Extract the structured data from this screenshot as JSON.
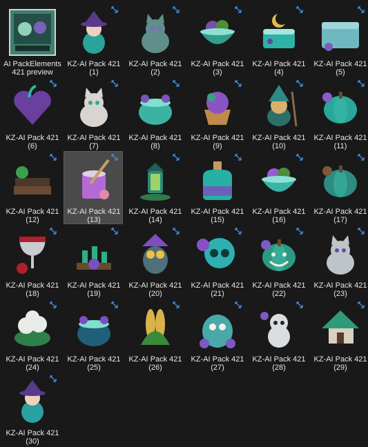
{
  "explorer": {
    "items": [
      {
        "line1": "AI PackElements",
        "line2": "421 preview",
        "kind": "preview",
        "color": "#3f7f6f",
        "accent": "#8fd3b8"
      },
      {
        "line1": "KZ-AI Pack 421",
        "line2": "(1)",
        "kind": "girl",
        "color": "#2aa39a",
        "accent": "#5b3a8c"
      },
      {
        "line1": "KZ-AI Pack 421",
        "line2": "(2)",
        "kind": "cat",
        "color": "#5f8f8a",
        "accent": "#8a67c4"
      },
      {
        "line1": "KZ-AI Pack 421",
        "line2": "(3)",
        "kind": "bowl",
        "color": "#2f9e8a",
        "accent": "#7a4ea8"
      },
      {
        "line1": "KZ-AI Pack 421",
        "line2": "(4)",
        "kind": "cake",
        "color": "#2bb3a5",
        "accent": "#6b42a3"
      },
      {
        "line1": "KZ-AI Pack 421",
        "line2": "(5)",
        "kind": "box",
        "color": "#6fb8c0",
        "accent": "#7f5bc0"
      },
      {
        "line1": "KZ-AI Pack 421",
        "line2": "(6)",
        "kind": "heart",
        "color": "#6a3fa0",
        "accent": "#2fb3a7"
      },
      {
        "line1": "KZ-AI Pack 421",
        "line2": "(7)",
        "kind": "cat",
        "color": "#d9d4cf",
        "accent": "#2fa89a"
      },
      {
        "line1": "KZ-AI Pack 421",
        "line2": "(8)",
        "kind": "cauldron",
        "color": "#3cb3a1",
        "accent": "#7a56b6"
      },
      {
        "line1": "KZ-AI Pack 421",
        "line2": "(9)",
        "kind": "cupcake",
        "color": "#c08a4a",
        "accent": "#8a55c2"
      },
      {
        "line1": "KZ-AI Pack 421",
        "line2": "(10)",
        "kind": "witch",
        "color": "#2f8a86",
        "accent": "#d9b070"
      },
      {
        "line1": "KZ-AI Pack 421",
        "line2": "(11)",
        "kind": "pumpkin",
        "color": "#2aa69a",
        "accent": "#8a5cc9"
      },
      {
        "line1": "KZ-AI Pack 421",
        "line2": "(12)",
        "kind": "books",
        "color": "#6b4a33",
        "accent": "#3aa04c"
      },
      {
        "line1": "KZ-AI Pack 421",
        "line2": "(13)",
        "kind": "paint",
        "color": "#b46ad3",
        "accent": "#e0d0e8"
      },
      {
        "line1": "KZ-AI Pack 421",
        "line2": "(14)",
        "kind": "lantern",
        "color": "#2b8a7a",
        "accent": "#9bd36a"
      },
      {
        "line1": "KZ-AI Pack 421",
        "line2": "(15)",
        "kind": "potion",
        "color": "#27b0a4",
        "accent": "#7d4dc0"
      },
      {
        "line1": "KZ-AI Pack 421",
        "line2": "(16)",
        "kind": "bowl",
        "color": "#3ab4a6",
        "accent": "#9a5bd2"
      },
      {
        "line1": "KZ-AI Pack 421",
        "line2": "(17)",
        "kind": "pumpkin",
        "color": "#2d8c7f",
        "accent": "#7a5a3a"
      },
      {
        "line1": "KZ-AI Pack 421",
        "line2": "(18)",
        "kind": "goblet",
        "color": "#c9ccd0",
        "accent": "#b0202a"
      },
      {
        "line1": "KZ-AI Pack 421",
        "line2": "(19)",
        "kind": "candles",
        "color": "#2fae8a",
        "accent": "#7a4fc0"
      },
      {
        "line1": "KZ-AI Pack 421",
        "line2": "(20)",
        "kind": "owl",
        "color": "#4f6f7a",
        "accent": "#7d4ec0"
      },
      {
        "line1": "KZ-AI Pack 421",
        "line2": "(21)",
        "kind": "skull",
        "color": "#2fb0b0",
        "accent": "#8a4fc8"
      },
      {
        "line1": "KZ-AI Pack 421",
        "line2": "(22)",
        "kind": "pumpkin-face",
        "color": "#2c9a80",
        "accent": "#7d5bc4"
      },
      {
        "line1": "KZ-AI Pack 421",
        "line2": "(23)",
        "kind": "cat",
        "color": "#bfc4c8",
        "accent": "#6a4aa6"
      },
      {
        "line1": "KZ-AI Pack 421",
        "line2": "(24)",
        "kind": "flowers",
        "color": "#e8ece6",
        "accent": "#2f7f4a"
      },
      {
        "line1": "KZ-AI Pack 421",
        "line2": "(25)",
        "kind": "cauldron",
        "color": "#1f5f7a",
        "accent": "#7a4fc4"
      },
      {
        "line1": "KZ-AI Pack 421",
        "line2": "(26)",
        "kind": "corn",
        "color": "#d9b24a",
        "accent": "#3b8a3a"
      },
      {
        "line1": "KZ-AI Pack 421",
        "line2": "(27)",
        "kind": "monster",
        "color": "#4aa8a8",
        "accent": "#7a5bc4"
      },
      {
        "line1": "KZ-AI Pack 421",
        "line2": "(28)",
        "kind": "panda",
        "color": "#dadde0",
        "accent": "#3a9a9a"
      },
      {
        "line1": "KZ-AI Pack 421",
        "line2": "(29)",
        "kind": "house",
        "color": "#2e9a7a",
        "accent": "#d8d0c0"
      },
      {
        "line1": "KZ-AI Pack 421",
        "line2": "(30)",
        "kind": "baby",
        "color": "#2aa0a0",
        "accent": "#5a3a8c"
      }
    ],
    "selected_index": 13,
    "sync_icon_color": "#3d8ee0"
  }
}
